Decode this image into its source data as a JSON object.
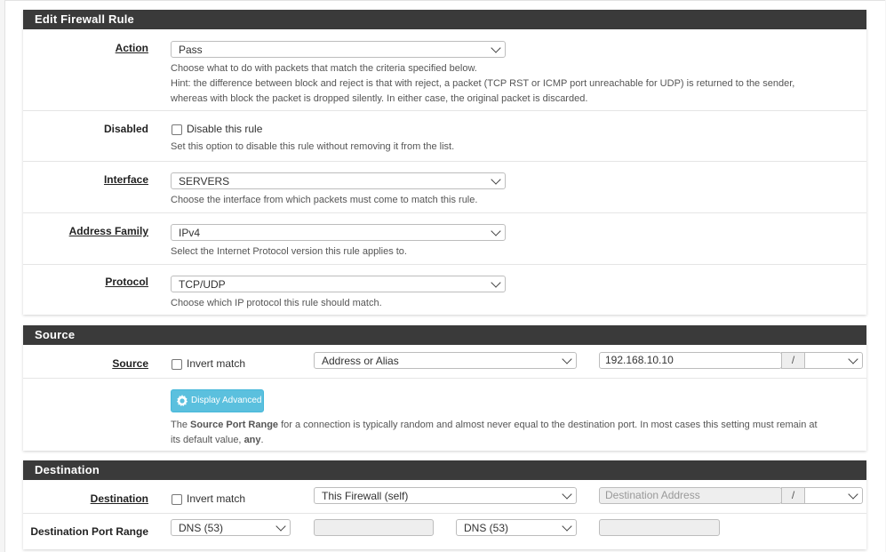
{
  "edit_panel": {
    "title": "Edit Firewall Rule",
    "action": {
      "label": "Action",
      "value": "Pass",
      "help_line1": "Choose what to do with packets that match the criteria specified below.",
      "help_line2": "Hint: the difference between block and reject is that with reject, a packet (TCP RST or ICMP port unreachable for UDP) is returned to the sender,",
      "help_line3": "whereas with block the packet is dropped silently. In either case, the original packet is discarded."
    },
    "disabled": {
      "label": "Disabled",
      "checkbox_label": "Disable this rule",
      "help": "Set this option to disable this rule without removing it from the list."
    },
    "interface": {
      "label": "Interface",
      "value": "SERVERS",
      "help": "Choose the interface from which packets must come to match this rule."
    },
    "address_family": {
      "label": "Address Family",
      "value": "IPv4",
      "help": "Select the Internet Protocol version this rule applies to."
    },
    "protocol": {
      "label": "Protocol",
      "value": "TCP/UDP",
      "help": "Choose which IP protocol this rule should match."
    }
  },
  "source_panel": {
    "title": "Source",
    "label": "Source",
    "invert_label": "Invert match",
    "type_value": "Address or Alias",
    "address_value": "192.168.10.10",
    "slash": "/",
    "advanced_button": "Display Advanced",
    "help_pre": "The ",
    "help_bold": "Source Port Range",
    "help_mid": " for a connection is typically random and almost never equal to the destination port. In most cases this setting must remain at",
    "help_line2_pre": "its default value, ",
    "help_line2_bold": "any",
    "help_line2_post": "."
  },
  "destination_panel": {
    "title": "Destination",
    "label": "Destination",
    "invert_label": "Invert match",
    "type_value": "This Firewall (self)",
    "address_placeholder": "Destination Address",
    "slash": "/",
    "port_range_label": "Destination Port Range",
    "from_port_value": "DNS (53)",
    "to_port_value": "DNS (53)"
  }
}
